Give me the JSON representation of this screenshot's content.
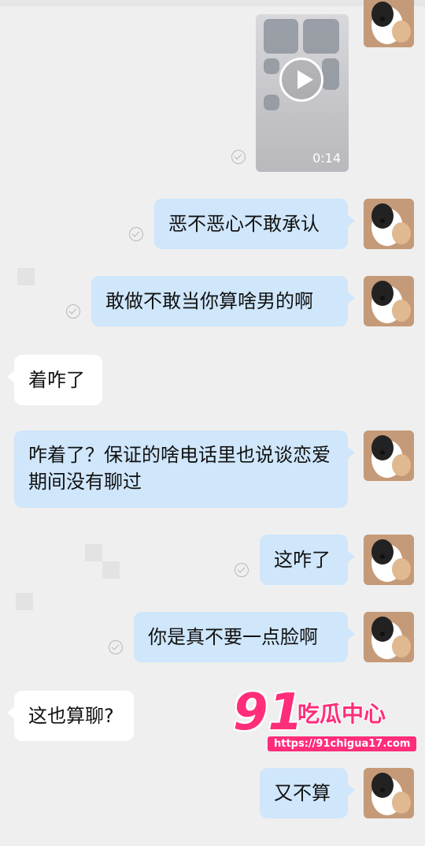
{
  "video": {
    "duration": "0:14"
  },
  "messages": [
    {
      "text": "恶不恶心不敢承认"
    },
    {
      "text": "敢做不敢当你算啥男的啊"
    },
    {
      "text": "着咋了"
    },
    {
      "text": "咋着了？保证的啥电话里也说谈恋爱期间没有聊过"
    },
    {
      "text": "这咋了"
    },
    {
      "text": "你是真不要一点脸啊"
    },
    {
      "text": "这也算聊?"
    },
    {
      "text": "又不算"
    }
  ],
  "watermark": {
    "number": "91",
    "brand": "吃瓜中心",
    "url": "https://91chigua17.com"
  },
  "colors": {
    "background": "#efefef",
    "bubble_mine": "#cfe6fb",
    "bubble_theirs": "#ffffff",
    "watermark": "#ff2d7a"
  }
}
